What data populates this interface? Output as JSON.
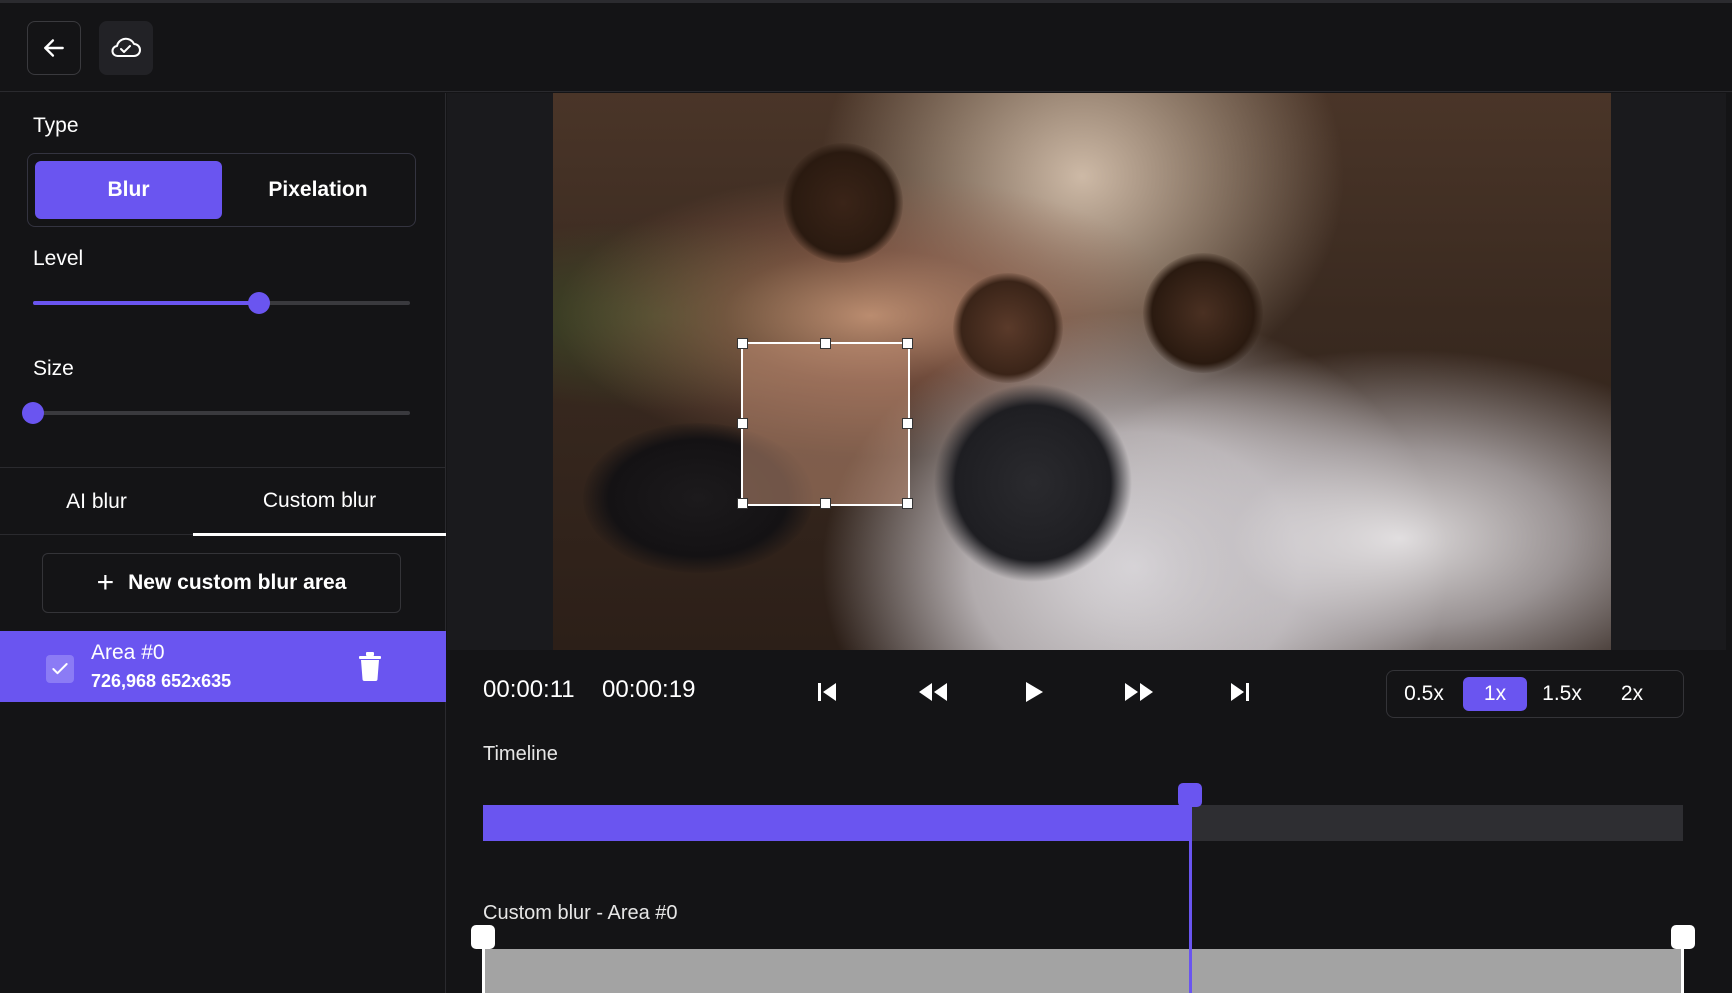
{
  "topbar": {
    "back_icon": "arrow-left-icon",
    "cloud_icon": "cloud-check-icon"
  },
  "sidebar": {
    "type_label": "Type",
    "type_options": [
      "Blur",
      "Pixelation"
    ],
    "type_selected": "Blur",
    "level_label": "Level",
    "level_value": 0.6,
    "size_label": "Size",
    "size_value": 0.0,
    "tabs": [
      {
        "label": "AI blur",
        "active": false
      },
      {
        "label": "Custom blur",
        "active": true
      }
    ],
    "new_area_label": "New custom blur area",
    "areas": [
      {
        "name": "Area #0",
        "dims": "726,968 652x635",
        "checked": true
      }
    ]
  },
  "player": {
    "current_time": "00:00:11",
    "total_time": "00:00:19",
    "controls": [
      "skip-start-icon",
      "rewind-icon",
      "play-icon",
      "fast-forward-icon",
      "skip-end-icon"
    ],
    "speeds": [
      "0.5x",
      "1x",
      "1.5x",
      "2x"
    ],
    "speed_selected": "1x"
  },
  "timeline": {
    "label": "Timeline",
    "progress": 0.589,
    "track_label": "Custom blur - Area #0",
    "range_start": 0.0,
    "range_end": 1.0
  },
  "colors": {
    "accent": "#6a55f0",
    "background": "#141416"
  }
}
